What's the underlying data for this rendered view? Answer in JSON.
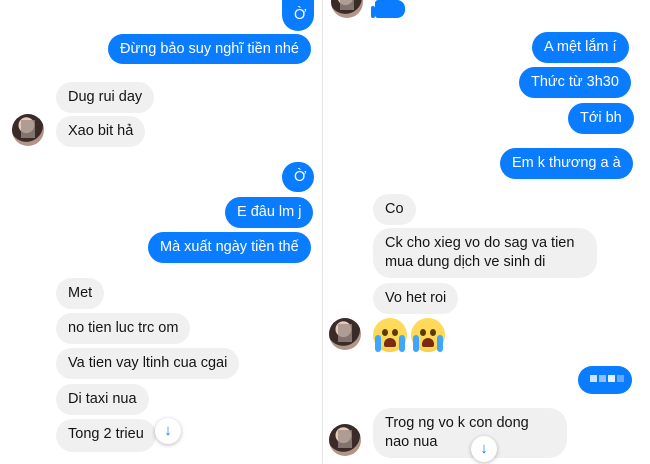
{
  "left": {
    "outgoing": [
      "Ờ",
      "Đừng bảo suy nghĩ tiền nhé",
      "Ờ",
      "E đâu lm j",
      "Mà xuất ngày tiền thế"
    ],
    "incoming": [
      "Dug rui day",
      "Xao bit hả",
      "Met",
      "no tien luc trc om",
      "Va tien vay ltinh cua cgai",
      "Di taxi nua",
      "Tong 2 trieu"
    ]
  },
  "right": {
    "outgoing": [
      "A mệt lắm í",
      "Thức từ 3h30",
      "Tới bh",
      "Em k thương a à"
    ],
    "incoming": [
      "Co",
      "Ck cho xieg vo do sag va tien mua dung dịch ve sinh di",
      "Vo het roi",
      "Trog ng vo k con dong nao nua"
    ]
  },
  "icons": {
    "scroll_down": "↓"
  },
  "colors": {
    "outgoing_bubble": "#0a7cff",
    "incoming_bubble": "#f0f0f0"
  }
}
